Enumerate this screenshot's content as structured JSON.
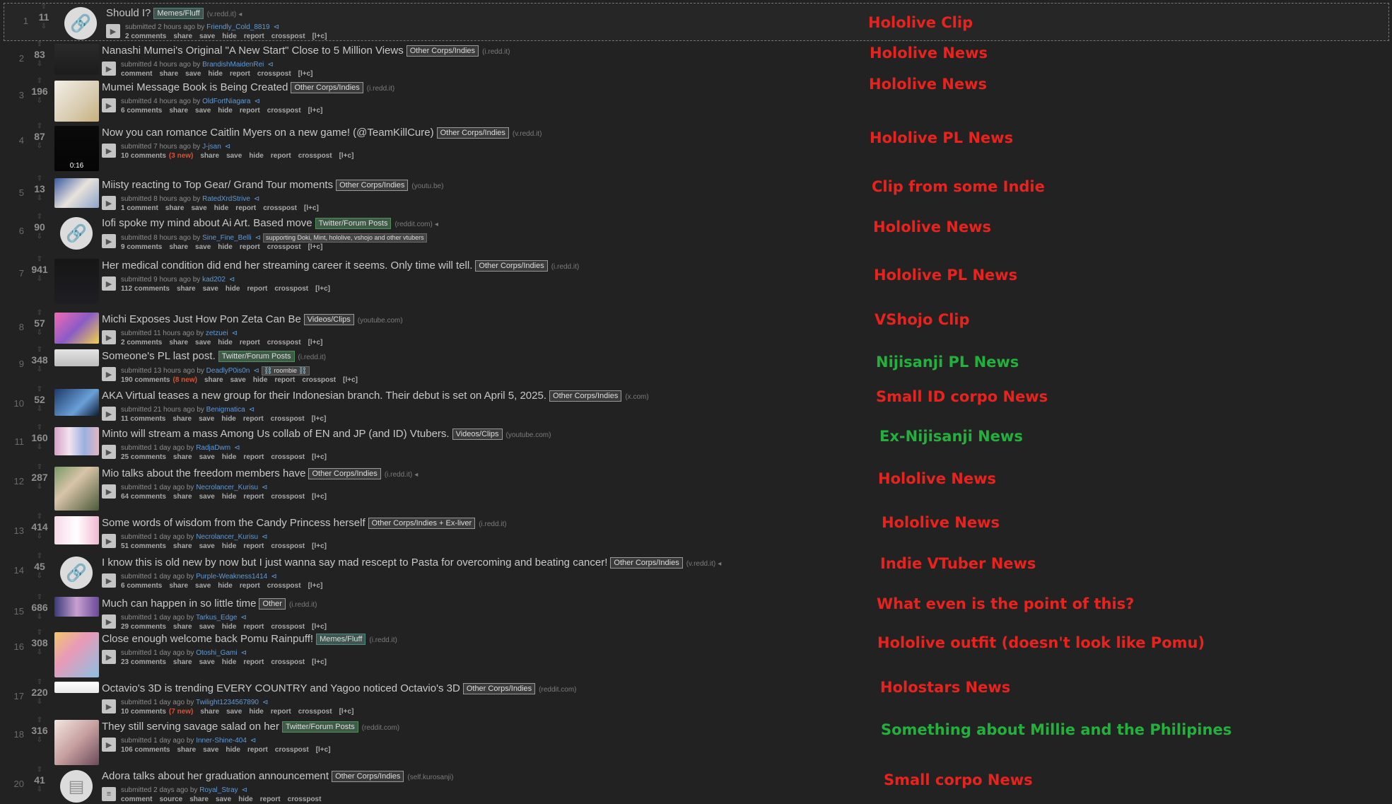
{
  "labels": {
    "submitted": "submitted",
    "by": "by",
    "share": "share",
    "save": "save",
    "hide": "hide",
    "report": "report",
    "crosspost": "crosspost",
    "comment": "comment",
    "source": "source",
    "expando": "[l+c]"
  },
  "posts": [
    {
      "rank": "1",
      "score": "11",
      "title": "Should I?",
      "flair": "Memes/Fluff",
      "flair_color": "teal",
      "domain": "(v.redd.it)",
      "submitted": "2 hours ago",
      "author": "Friendly_Cold_8819",
      "comments": "2 comments",
      "new": "",
      "annotation": "Hololive Clip",
      "annotation_color": "red",
      "thumb": "link"
    },
    {
      "rank": "2",
      "score": "83",
      "title": "Nanashi Mumei's Original \"A New Start\" Close to 5 Million Views",
      "flair": "Other Corps/Indies",
      "flair_color": "grey",
      "domain": "(i.redd.it)",
      "submitted": "4 hours ago",
      "author": "BrandishMaidenRei",
      "comments": "comment",
      "new": "",
      "annotation": "Hololive News",
      "annotation_color": "red",
      "thumb": "img"
    },
    {
      "rank": "3",
      "score": "196",
      "title": "Mumei Message Book is Being Created",
      "flair": "Other Corps/Indies",
      "flair_color": "grey",
      "domain": "(i.redd.it)",
      "submitted": "4 hours ago",
      "author": "OldFortNiagara",
      "comments": "6 comments",
      "new": "",
      "annotation": "Hololive News",
      "annotation_color": "red",
      "thumb": "img"
    },
    {
      "rank": "4",
      "score": "87",
      "title": "Now you can romance Caitlin Myers on a new game! (@TeamKillCure)",
      "flair": "Other Corps/Indies",
      "flair_color": "grey",
      "domain": "(v.redd.it)",
      "submitted": "7 hours ago",
      "author": "J-jsan",
      "comments": "10 comments",
      "new": "(3 new)",
      "annotation": "Hololive PL News",
      "annotation_color": "red",
      "thumb": "video",
      "duration": "0:16"
    },
    {
      "rank": "5",
      "score": "13",
      "title": "Miisty reacting to Top Gear/ Grand Tour moments",
      "flair": "Other Corps/Indies",
      "flair_color": "grey",
      "domain": "(youtu.be)",
      "submitted": "8 hours ago",
      "author": "RatedXrdStrive",
      "comments": "1 comment",
      "new": "",
      "annotation": "Clip from some Indie",
      "annotation_color": "red",
      "thumb": "img"
    },
    {
      "rank": "6",
      "score": "90",
      "title": "Iofi spoke my mind about Ai Art. Based move",
      "flair": "Twitter/Forum Posts",
      "flair_color": "green",
      "domain": "(reddit.com)",
      "submitted": "8 hours ago",
      "author": "Sine_Fine_Belli",
      "user_flair": "supporting Doki, Mint, hololive, vshojo and other vtubers",
      "comments": "9 comments",
      "new": "",
      "annotation": "Hololive News",
      "annotation_color": "red",
      "thumb": "link"
    },
    {
      "rank": "7",
      "score": "941",
      "title": "Her medical condition did end her streaming career it seems. Only time will tell.",
      "flair": "Other Corps/Indies",
      "flair_color": "grey",
      "domain": "(i.redd.it)",
      "submitted": "9 hours ago",
      "author": "kad202",
      "comments": "112 comments",
      "new": "",
      "annotation": "Hololive PL News",
      "annotation_color": "red",
      "thumb": "img"
    },
    {
      "rank": "8",
      "score": "57",
      "title": "Michi Exposes Just How Pon Zeta Can Be",
      "flair": "Videos/Clips",
      "flair_color": "grey",
      "domain": "(youtube.com)",
      "submitted": "11 hours ago",
      "author": "zetzuei",
      "comments": "2 comments",
      "new": "",
      "annotation": "VShojo Clip",
      "annotation_color": "red",
      "thumb": "img"
    },
    {
      "rank": "9",
      "score": "348",
      "title": "Someone's PL last post.",
      "flair": "Twitter/Forum Posts",
      "flair_color": "green",
      "domain": "(i.redd.it)",
      "submitted": "13 hours ago",
      "author": "DeadlyP0is0n",
      "user_flair": "⛓️ roombie ⛓️",
      "comments": "190 comments",
      "new": "(8 new)",
      "annotation": "Nijisanji PL News",
      "annotation_color": "green",
      "thumb": "img"
    },
    {
      "rank": "10",
      "score": "52",
      "title": "AKA Virtual teases a new group for their Indonesian branch. Their debut is set on April 5, 2025.",
      "flair": "Other Corps/Indies",
      "flair_color": "grey",
      "domain": "(x.com)",
      "submitted": "21 hours ago",
      "author": "Benigmatica",
      "comments": "11 comments",
      "new": "",
      "annotation": "Small ID corpo News",
      "annotation_color": "red",
      "thumb": "img"
    },
    {
      "rank": "11",
      "score": "160",
      "title": "Minto will stream a mass Among Us collab of EN and JP (and ID) Vtubers.",
      "flair": "Videos/Clips",
      "flair_color": "grey",
      "domain": "(youtube.com)",
      "submitted": "1 day ago",
      "author": "RadjaDwm",
      "comments": "25 comments",
      "new": "",
      "annotation": "Ex-Nijisanji News",
      "annotation_color": "green",
      "thumb": "img"
    },
    {
      "rank": "12",
      "score": "287",
      "title": "Mio talks about the freedom members have",
      "flair": "Other Corps/Indies",
      "flair_color": "grey",
      "domain": "(i.redd.it)",
      "submitted": "1 day ago",
      "author": "Necrolancer_Kurisu",
      "comments": "64 comments",
      "new": "",
      "annotation": "Hololive News",
      "annotation_color": "red",
      "thumb": "img"
    },
    {
      "rank": "13",
      "score": "414",
      "title": "Some words of wisdom from the Candy Princess herself",
      "flair": "Other Corps/Indies + Ex-liver",
      "flair_color": "grey",
      "domain": "(i.redd.it)",
      "submitted": "1 day ago",
      "author": "Necrolancer_Kurisu",
      "comments": "51 comments",
      "new": "",
      "annotation": "Hololive News",
      "annotation_color": "red",
      "thumb": "img"
    },
    {
      "rank": "14",
      "score": "45",
      "title": "I know this is old new by now but I just wanna say mad rescept to Pasta for overcoming and beating cancer!",
      "flair": "Other Corps/Indies",
      "flair_color": "grey",
      "domain": "(v.redd.it)",
      "submitted": "1 day ago",
      "author": "Purple-Weakness1414",
      "comments": "6 comments",
      "new": "",
      "annotation": "Indie VTuber News",
      "annotation_color": "red",
      "thumb": "link"
    },
    {
      "rank": "15",
      "score": "686",
      "title": "Much can happen in so little time",
      "flair": "Other",
      "flair_color": "grey",
      "domain": "(i.redd.it)",
      "submitted": "1 day ago",
      "author": "Tarkus_Edge",
      "comments": "29 comments",
      "new": "",
      "annotation": "What even is the point of this?",
      "annotation_color": "red",
      "thumb": "img"
    },
    {
      "rank": "16",
      "score": "308",
      "title": "Close enough welcome back Pomu Rainpuff!",
      "flair": "Memes/Fluff",
      "flair_color": "teal",
      "domain": "(i.redd.it)",
      "submitted": "1 day ago",
      "author": "Otoshi_Gami",
      "comments": "23 comments",
      "new": "",
      "annotation": "Hololive outfit (doesn't look like Pomu)",
      "annotation_color": "red",
      "thumb": "img"
    },
    {
      "rank": "17",
      "score": "220",
      "title": "Octavio's 3D is trending EVERY COUNTRY and Yagoo noticed Octavio's 3D",
      "flair": "Other Corps/Indies",
      "flair_color": "grey",
      "domain": "(reddit.com)",
      "submitted": "1 day ago",
      "author": "Twilight1234567890",
      "comments": "10 comments",
      "new": "(7 new)",
      "annotation": "Holostars News",
      "annotation_color": "red",
      "thumb": "img"
    },
    {
      "rank": "18",
      "score": "316",
      "title": "They still serving savage salad on her",
      "flair": "Twitter/Forum Posts",
      "flair_color": "green",
      "domain": "(reddit.com)",
      "submitted": "1 day ago",
      "author": "Inner-Shine-404",
      "comments": "106 comments",
      "new": "",
      "annotation": "Something about Millie and the Philipines",
      "annotation_color": "green",
      "thumb": "img"
    },
    {
      "rank": "20",
      "score": "41",
      "title": "Adora talks about her graduation announcement",
      "flair": "Other Corps/Indies",
      "flair_color": "grey",
      "domain": "(self.kurosanji)",
      "submitted": "2 days ago",
      "author": "Royal_Stray",
      "comments": "comment",
      "new": "",
      "annotation": "Small corpo News",
      "annotation_color": "red",
      "thumb": "text",
      "self": true
    }
  ]
}
